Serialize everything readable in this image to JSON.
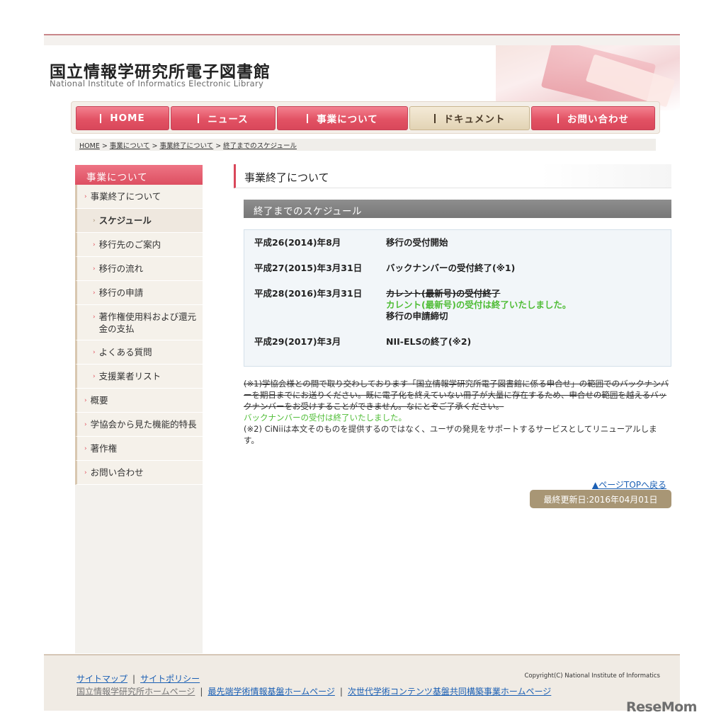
{
  "header": {
    "title": "国立情報学研究所電子図書館",
    "subtitle": "National Institute of Informatics Electronic Library"
  },
  "nav": [
    {
      "label": "HOME"
    },
    {
      "label": "ニュース"
    },
    {
      "label": "事業について"
    },
    {
      "label": "ドキュメント"
    },
    {
      "label": "お問い合わせ"
    }
  ],
  "breadcrumb": [
    "HOME",
    "事業について",
    "事業終了について",
    "終了までのスケジュール"
  ],
  "breadcrumb_sep": ">",
  "sidebar": {
    "heading": "事業について",
    "items": [
      {
        "label": "事業終了について"
      },
      {
        "label": "スケジュール"
      },
      {
        "label": "移行先のご案内"
      },
      {
        "label": "移行の流れ"
      },
      {
        "label": "移行の申請"
      },
      {
        "label": "著作権使用料および還元金の支払"
      },
      {
        "label": "よくある質問"
      },
      {
        "label": "支援業者リスト"
      },
      {
        "label": "概要"
      },
      {
        "label": "学協会から見た機能的特長"
      },
      {
        "label": "著作権"
      },
      {
        "label": "お問い合わせ"
      }
    ],
    "marker": "›"
  },
  "main": {
    "page_title": "事業終了について",
    "section_title": "終了までのスケジュール",
    "schedule": [
      {
        "date": "平成26(2014)年8月",
        "desc": "移行の受付開始"
      },
      {
        "date": "平成27(2015)年3月31日",
        "desc": "バックナンバーの受付終了(※1)"
      },
      {
        "date": "平成28(2016)年3月31日",
        "desc_struck": "カレント(最新号)の受付終了",
        "desc_green": "カレント(最新号)の受付は終了いたしました。",
        "desc_extra": "移行の申請締切"
      },
      {
        "date": "平成29(2017)年3月",
        "desc": "NII-ELSの終了(※2)"
      }
    ],
    "note1_struck": "(※1)学協会様との間で取り交わしております「国立情報学研究所電子図書館に係る申合せ」の範囲でのバックナンバーを期日までにお送りください。既に電子化を終えていない冊子が大量に存在するため、申合せの範囲を越えるバックナンバーをお受けすることができません。なにとぞご了承ください。",
    "note1_green": "バックナンバーの受付は終了いたしました。",
    "note2": "(※2) CiNiiは本文そのものを提供するのではなく、ユーザの発見をサポートするサービスとしてリニューアルします。",
    "page_top": "▲ページTOPへ戻る",
    "last_updated": "最終更新日:2016年04月01日"
  },
  "footer": {
    "sitemap": "サイトマップ",
    "policy": "サイトポリシー",
    "nii_home": "国立情報学研究所ホームページ",
    "csi_home": "最先端学術情報基盤ホームページ",
    "next_home": "次世代学術コンテンツ基盤共同構築事業ホームページ",
    "copyright": "Copyright(C) National Institute of Informatics",
    "pipe": "|"
  },
  "watermark": "ReseMom",
  "colors": {
    "accent": "#dd4f61",
    "green": "#4fbd36",
    "link": "#1a5fb4"
  }
}
